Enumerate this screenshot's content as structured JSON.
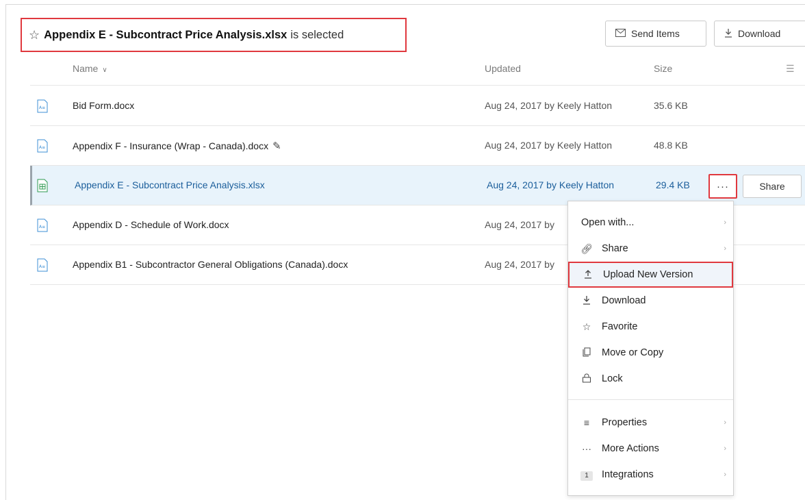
{
  "selection": {
    "file_name": "Appendix E - Subcontract Price Analysis.xlsx",
    "suffix": "is selected"
  },
  "toolbar": {
    "send_items_label": "Send Items",
    "download_label": "Download"
  },
  "table": {
    "columns": {
      "name": "Name",
      "updated": "Updated",
      "size": "Size"
    },
    "rows": [
      {
        "name": "Bid Form.docx",
        "updated": "Aug 24, 2017 by Keely Hatton",
        "size": "35.6 KB",
        "type": "docx"
      },
      {
        "name": "Appendix F - Insurance (Wrap - Canada).docx",
        "updated": "Aug 24, 2017 by Keely Hatton",
        "size": "48.8 KB",
        "type": "docx"
      },
      {
        "name": "Appendix E - Subcontract Price Analysis.xlsx",
        "updated": "Aug 24, 2017 by Keely Hatton",
        "size": "29.4 KB",
        "type": "xlsx",
        "selected": true
      },
      {
        "name": "Appendix D - Schedule of Work.docx",
        "updated": "Aug 24, 2017 by",
        "size": "",
        "type": "docx"
      },
      {
        "name": "Appendix B1 - Subcontractor General Obligations (Canada).docx",
        "updated": "Aug 24, 2017 by",
        "size": "",
        "type": "docx"
      }
    ],
    "more_label": "···",
    "share_label": "Share"
  },
  "menu": {
    "items": [
      {
        "label": "Open with...",
        "icon": "none",
        "submenu": true
      },
      {
        "label": "Share",
        "icon": "link-icon",
        "submenu": true
      },
      {
        "label": "Upload New Version",
        "icon": "upload-icon",
        "submenu": false
      },
      {
        "label": "Download",
        "icon": "download-icon",
        "submenu": false
      },
      {
        "label": "Favorite",
        "icon": "star-icon",
        "submenu": false
      },
      {
        "label": "Move or Copy",
        "icon": "copy-icon",
        "submenu": false
      },
      {
        "label": "Lock",
        "icon": "lock-icon",
        "submenu": false
      },
      {
        "label": "Properties",
        "icon": "properties-icon",
        "submenu": true
      },
      {
        "label": "More Actions",
        "icon": "more-icon",
        "submenu": true
      },
      {
        "label": "Integrations",
        "icon": "integrations-badge",
        "submenu": true
      }
    ],
    "integrations_badge": "1"
  },
  "colors": {
    "highlight_red": "#e0383e",
    "selected_row_bg": "#e8f3fb",
    "selected_text": "#1b5e9b"
  }
}
